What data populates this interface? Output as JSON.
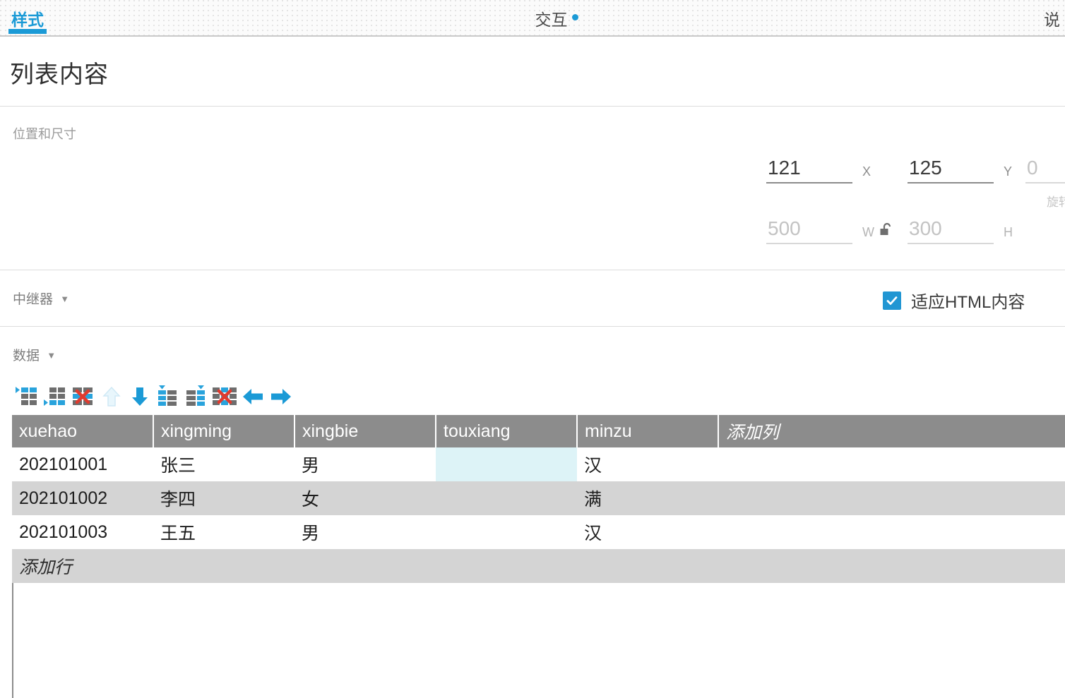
{
  "tabs": [
    {
      "label": "样式",
      "active": true
    },
    {
      "label": "交互",
      "active": false,
      "indicator": true
    },
    {
      "label": "说",
      "active": false
    }
  ],
  "page": {
    "title": "列表内容"
  },
  "sections": {
    "position_size": {
      "label": "位置和尺寸"
    },
    "repeater": {
      "label": "中继器",
      "caret": "▼"
    },
    "data": {
      "label": "数据",
      "caret": "▼"
    }
  },
  "position_size": {
    "x": {
      "value": "121",
      "unit": "X"
    },
    "y": {
      "value": "125",
      "unit": "Y"
    },
    "rotation": {
      "value": "0",
      "label": "旋转"
    },
    "w": {
      "value": "",
      "placeholder": "500",
      "unit": "W"
    },
    "h": {
      "value": "",
      "placeholder": "300",
      "unit": "H"
    },
    "lock_icon": "unlock-icon"
  },
  "repeater": {
    "fit_html": {
      "label": "适应HTML内容",
      "checked": true
    }
  },
  "toolbar": [
    {
      "name": "insert-row-above-icon",
      "label": "在上方插入行",
      "disabled": false
    },
    {
      "name": "insert-row-below-icon",
      "label": "在下方插入行",
      "disabled": false
    },
    {
      "name": "delete-row-icon",
      "label": "删除行",
      "disabled": false
    },
    {
      "name": "move-row-up-icon",
      "label": "上移行",
      "disabled": true
    },
    {
      "name": "move-row-down-icon",
      "label": "下移行",
      "disabled": false
    },
    {
      "name": "insert-column-left-icon",
      "label": "在左侧插入列",
      "disabled": false
    },
    {
      "name": "insert-column-right-icon",
      "label": "在右侧插入列",
      "disabled": false
    },
    {
      "name": "delete-column-icon",
      "label": "删除列",
      "disabled": false
    },
    {
      "name": "move-column-left-icon",
      "label": "左移列",
      "disabled": false
    },
    {
      "name": "move-column-right-icon",
      "label": "右移列",
      "disabled": false
    }
  ],
  "table": {
    "columns": [
      "xuehao",
      "xingming",
      "xingbie",
      "touxiang",
      "minzu"
    ],
    "add_column_label": "添加列",
    "add_row_label": "添加行",
    "rows": [
      {
        "xuehao": "202101001",
        "xingming": "张三",
        "xingbie": "男",
        "touxiang": "",
        "minzu": "汉"
      },
      {
        "xuehao": "202101002",
        "xingming": "李四",
        "xingbie": "女",
        "touxiang": "",
        "minzu": "满"
      },
      {
        "xuehao": "202101003",
        "xingming": "王五",
        "xingbie": "男",
        "touxiang": "",
        "minzu": "汉"
      }
    ],
    "selected_cell": {
      "row": 0,
      "column": "touxiang"
    }
  },
  "colors": {
    "accent": "#1b9ad6",
    "header_gray": "#8c8c8c",
    "row_alt": "#d4d4d4",
    "selection": "#ddf3f7",
    "icon_blue": "#29a3dc",
    "icon_gray": "#6e6e6e",
    "icon_red": "#e03b2f"
  }
}
